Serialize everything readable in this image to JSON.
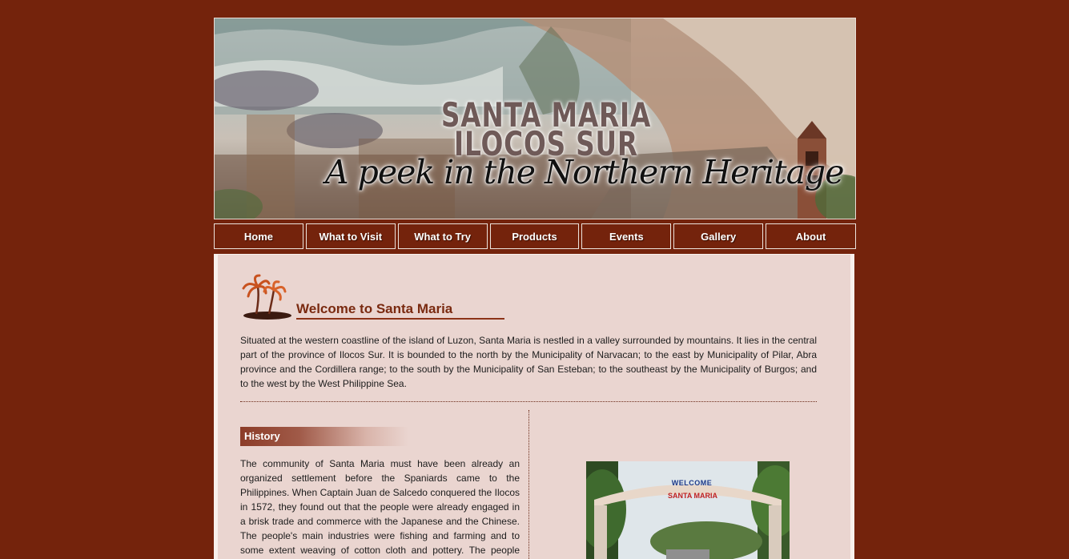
{
  "banner": {
    "line1": "SANTA MARIA",
    "line2": "ILOCOS SUR",
    "tagline": "A peek in the Northern Heritage"
  },
  "nav": {
    "items": [
      {
        "label": "Home"
      },
      {
        "label": "What to Visit"
      },
      {
        "label": "What to Try"
      },
      {
        "label": "Products"
      },
      {
        "label": "Events"
      },
      {
        "label": "Gallery"
      },
      {
        "label": "About"
      }
    ]
  },
  "welcome": {
    "title": "Welcome to Santa Maria",
    "text": "Situated at the western coastline of the island of Luzon, Santa Maria is nestled in a valley surrounded by mountains. It lies in the central part of the province of Ilocos Sur. It is bounded to the north by the Municipality of Narvacan; to the east by Municipality of Pilar, Abra province and the Cordillera range; to the south by the Municipality of San Esteban; to the southeast by the Municipality of Burgos; and to the west by the West Philippine Sea."
  },
  "history": {
    "title": "History",
    "text": "The community of Santa Maria must have been already an organized settlement before the Spaniards came to the Philippines. When Captain Juan de Salcedo conquered the Ilocos in 1572, they found out that the people were already engaged in a brisk trade and commerce with the Japanese and the Chinese. The people's main industries were fishing and farming and to some extent weaving of cotton cloth and pottery. The people were"
  },
  "photo": {
    "sign_top": "WELCOME",
    "sign_main": "SANTA MARIA"
  },
  "colors": {
    "background": "#74230c",
    "content_bg": "#ead5d0",
    "accent": "#7a2a10"
  }
}
